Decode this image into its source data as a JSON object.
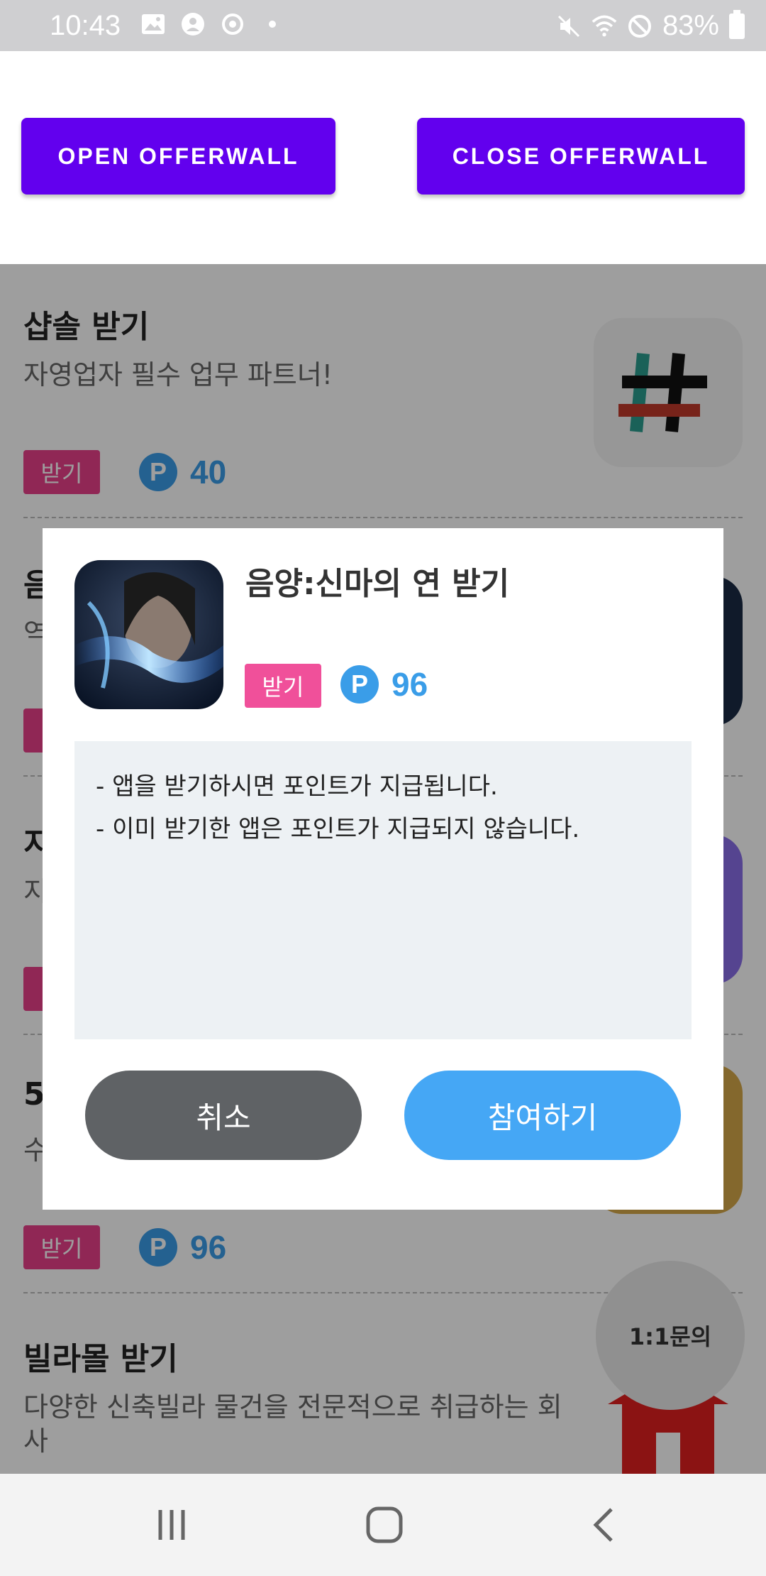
{
  "status_bar": {
    "time": "10:43",
    "battery": "83%",
    "icons": [
      "image-icon",
      "account-icon",
      "sync-icon",
      "dot-icon",
      "mute-icon",
      "wifi-icon",
      "blocked-icon",
      "battery-icon"
    ]
  },
  "buttons": {
    "open": "OPEN OFFERWALL",
    "close": "CLOSE OFFERWALL"
  },
  "list": [
    {
      "title": "샵솔 받기",
      "desc": "자영업자 필수 업무 파트너!",
      "badge": "받기",
      "points": "40"
    },
    {
      "title": "음",
      "desc": "역",
      "badge": "받기",
      "points": ""
    },
    {
      "title": "지",
      "desc": "지",
      "badge": "받기",
      "points": ""
    },
    {
      "title": "5",
      "desc": "수",
      "badge": "받기",
      "points": "96"
    },
    {
      "title": "빌라몰 받기",
      "desc": "다양한 신축빌라 물건을 전문적으로 취급하는 회사",
      "badge": "",
      "points": ""
    }
  ],
  "inquiry": "1:1문의",
  "dialog": {
    "title": "음양:신마의 연 받기",
    "badge": "받기",
    "points": "96",
    "point_symbol": "P",
    "lines": [
      "- 앱을 받기하시면 포인트가 지급됩니다.",
      "- 이미 받기한 앱은 포인트가 지급되지 않습니다."
    ],
    "cancel": "취소",
    "join": "참여하기"
  },
  "colors": {
    "primary_button": "#6200ee",
    "badge": "#f0509a",
    "point_blue": "#3a9de8",
    "cancel_button": "#5f6265",
    "join_button": "#45a7f5"
  }
}
